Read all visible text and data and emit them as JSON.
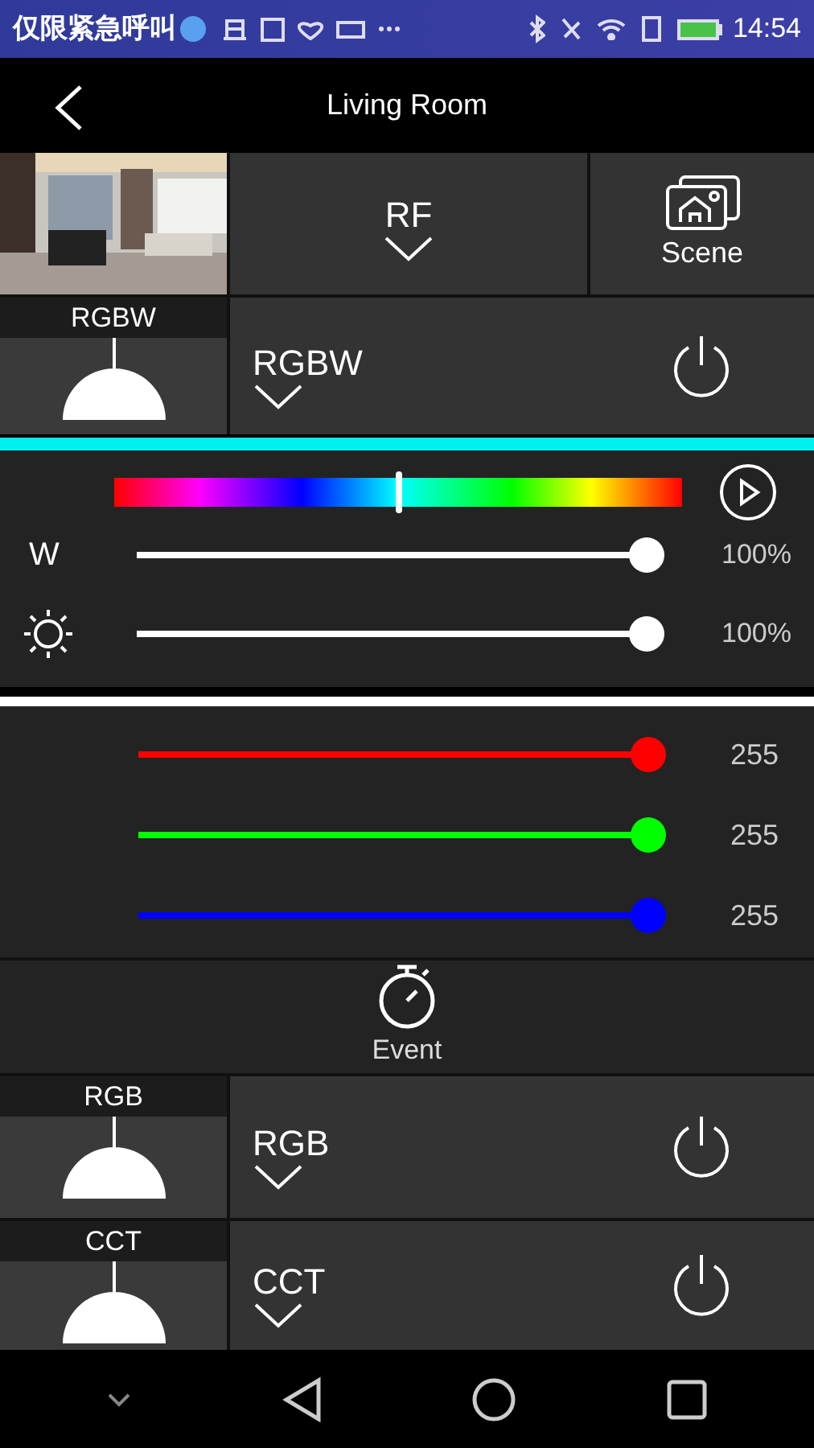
{
  "status_bar": {
    "carrier": "仅限紧急呼叫",
    "time": "14:54"
  },
  "header": {
    "title": "Living Room"
  },
  "top_panel": {
    "protocol": "RF",
    "scene": "Scene"
  },
  "active_device": {
    "type": "RGBW",
    "name": "RGBW"
  },
  "color_panel": {
    "hue": {
      "level": 0.5
    },
    "sliders": [
      {
        "kind": "text",
        "label": "W",
        "level": 1,
        "reading": "100%"
      },
      {
        "kind": "sun",
        "level": 1,
        "reading": "100%"
      }
    ]
  },
  "channels": [
    {
      "color": "#ff0000",
      "level": 1,
      "reading": "255"
    },
    {
      "color": "#00ff00",
      "level": 1,
      "reading": "255"
    },
    {
      "color": "#0000ff",
      "level": 1,
      "reading": "255"
    }
  ],
  "event": {
    "label": "Event"
  },
  "devices": [
    {
      "type": "RGB",
      "name": "RGB"
    },
    {
      "type": "CCT",
      "name": "CCT"
    }
  ]
}
